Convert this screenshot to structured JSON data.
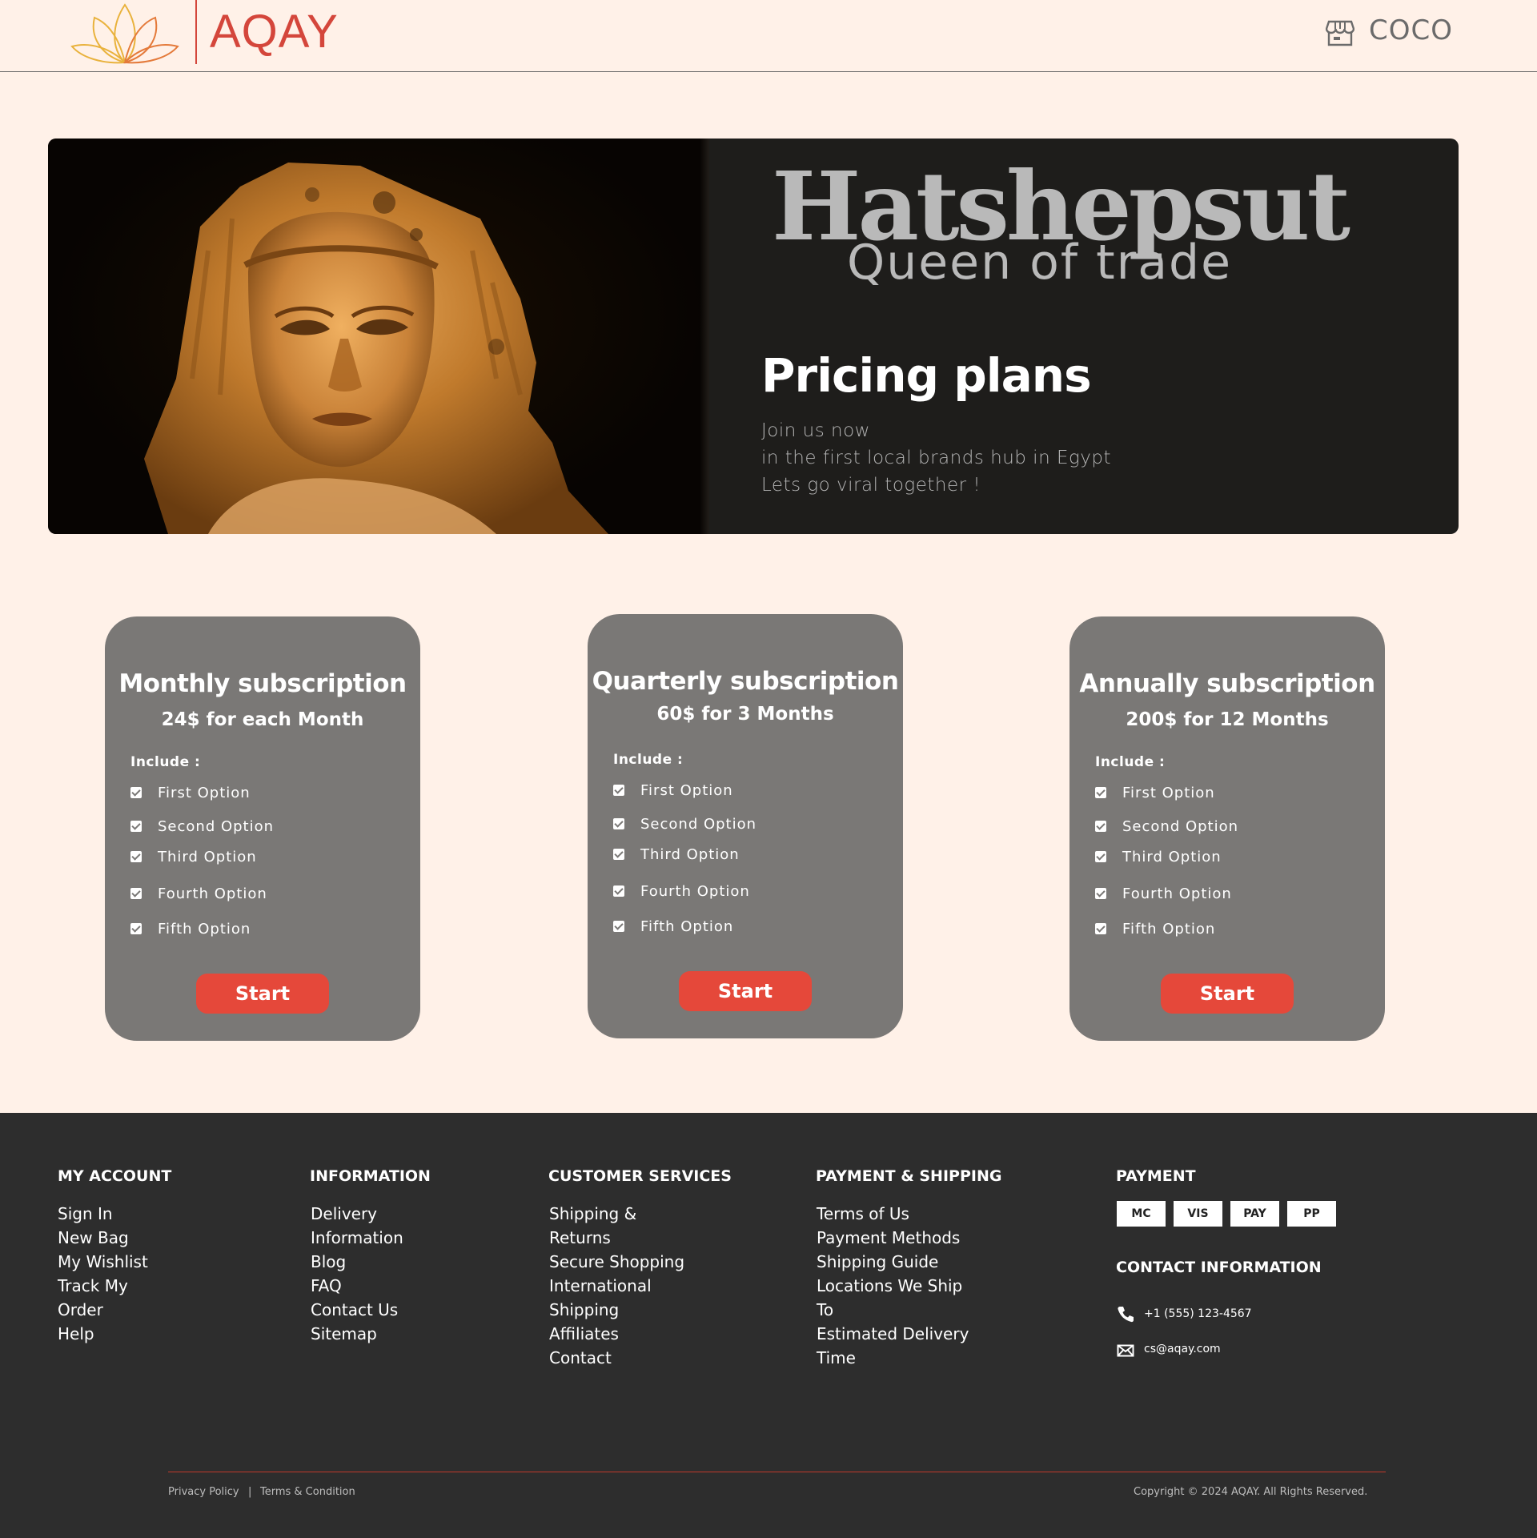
{
  "header": {
    "brand": "AQAY",
    "store_name": "COCO",
    "store_icon": "store-icon",
    "colors": {
      "brand": "#d4463b",
      "background": "#fff1e8"
    }
  },
  "hero": {
    "title": "Hatshepsut",
    "subtitle": "Queen of trade",
    "heading": "Pricing plans",
    "lines": [
      "Join us now",
      "in the first local brands hub in Egypt",
      "Lets go viral together !"
    ]
  },
  "plans": [
    {
      "title": "Monthly subscription",
      "price": "24$ for each Month",
      "include_label": "Include :",
      "options": [
        "First Option",
        "Second Option",
        "Third Option",
        "Fourth Option",
        "Fifth Option"
      ],
      "button": "Start"
    },
    {
      "title": "Quarterly subscription",
      "price": "60$ for 3 Months",
      "include_label": "Include :",
      "options": [
        "First Option",
        "Second Option",
        "Third Option",
        "Fourth Option",
        "Fifth Option"
      ],
      "button": "Start"
    },
    {
      "title": "Annually subscription",
      "price": "200$ for 12 Months",
      "include_label": "Include :",
      "options": [
        "First Option",
        "Second Option",
        "Third Option",
        "Fourth Option",
        "Fifth Option"
      ],
      "button": "Start"
    }
  ],
  "footer": {
    "my_account": {
      "heading": "MY ACCOUNT",
      "links": [
        "Sign In",
        "New Bag",
        "My Wishlist",
        "Track My",
        "Order",
        "Help"
      ]
    },
    "information": {
      "heading": "INFORMATION",
      "links": [
        "Delivery",
        "Information",
        "Blog",
        "FAQ",
        "Contact Us",
        "Sitemap"
      ]
    },
    "customer_services": {
      "heading": "CUSTOMER SERVICES",
      "links": [
        "Shipping &",
        "Returns",
        "Secure Shopping",
        "International",
        "Shipping",
        "Affiliates",
        "Contact"
      ]
    },
    "payment_shipping": {
      "heading": "PAYMENT & SHIPPING",
      "links": [
        "Terms of Us",
        "Payment Methods",
        "Shipping Guide",
        "Locations We Ship",
        "To",
        "Estimated Delivery",
        "Time"
      ]
    },
    "payment": {
      "heading": "PAYMENT",
      "badges": [
        "MC",
        "VIS",
        "PAY",
        "PP"
      ]
    },
    "contact": {
      "heading": "CONTACT INFORMATION",
      "phone": "+1 (555) 123-4567",
      "email": "cs@aqay.com",
      "phone_icon": "phone-icon",
      "email_icon": "mail-icon"
    },
    "bottom": {
      "privacy": "Privacy Policy",
      "separator": "|",
      "terms": "Terms & Condition",
      "copyright": "Copyright © 2024 AQAY. All Rights Reserved."
    },
    "colors": {
      "background": "#2d2d2d",
      "accent": "#e5483a"
    }
  }
}
